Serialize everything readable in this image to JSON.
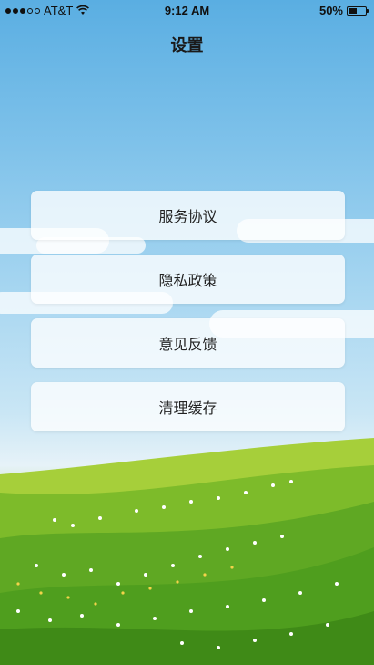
{
  "status_bar": {
    "carrier": "AT&T",
    "time": "9:12 AM",
    "battery": "50%",
    "battery_level": 0.5,
    "signal_bars_filled": 3,
    "signal_bars_total": 5
  },
  "page": {
    "title": "设置"
  },
  "menu": {
    "items": [
      {
        "label": "服务协议"
      },
      {
        "label": "隐私政策"
      },
      {
        "label": "意见反馈"
      },
      {
        "label": "清理缓存"
      }
    ]
  },
  "colors": {
    "sky_top": "#5aaee2",
    "grass": "#4f9e1e",
    "button_bg": "#ffffff"
  }
}
